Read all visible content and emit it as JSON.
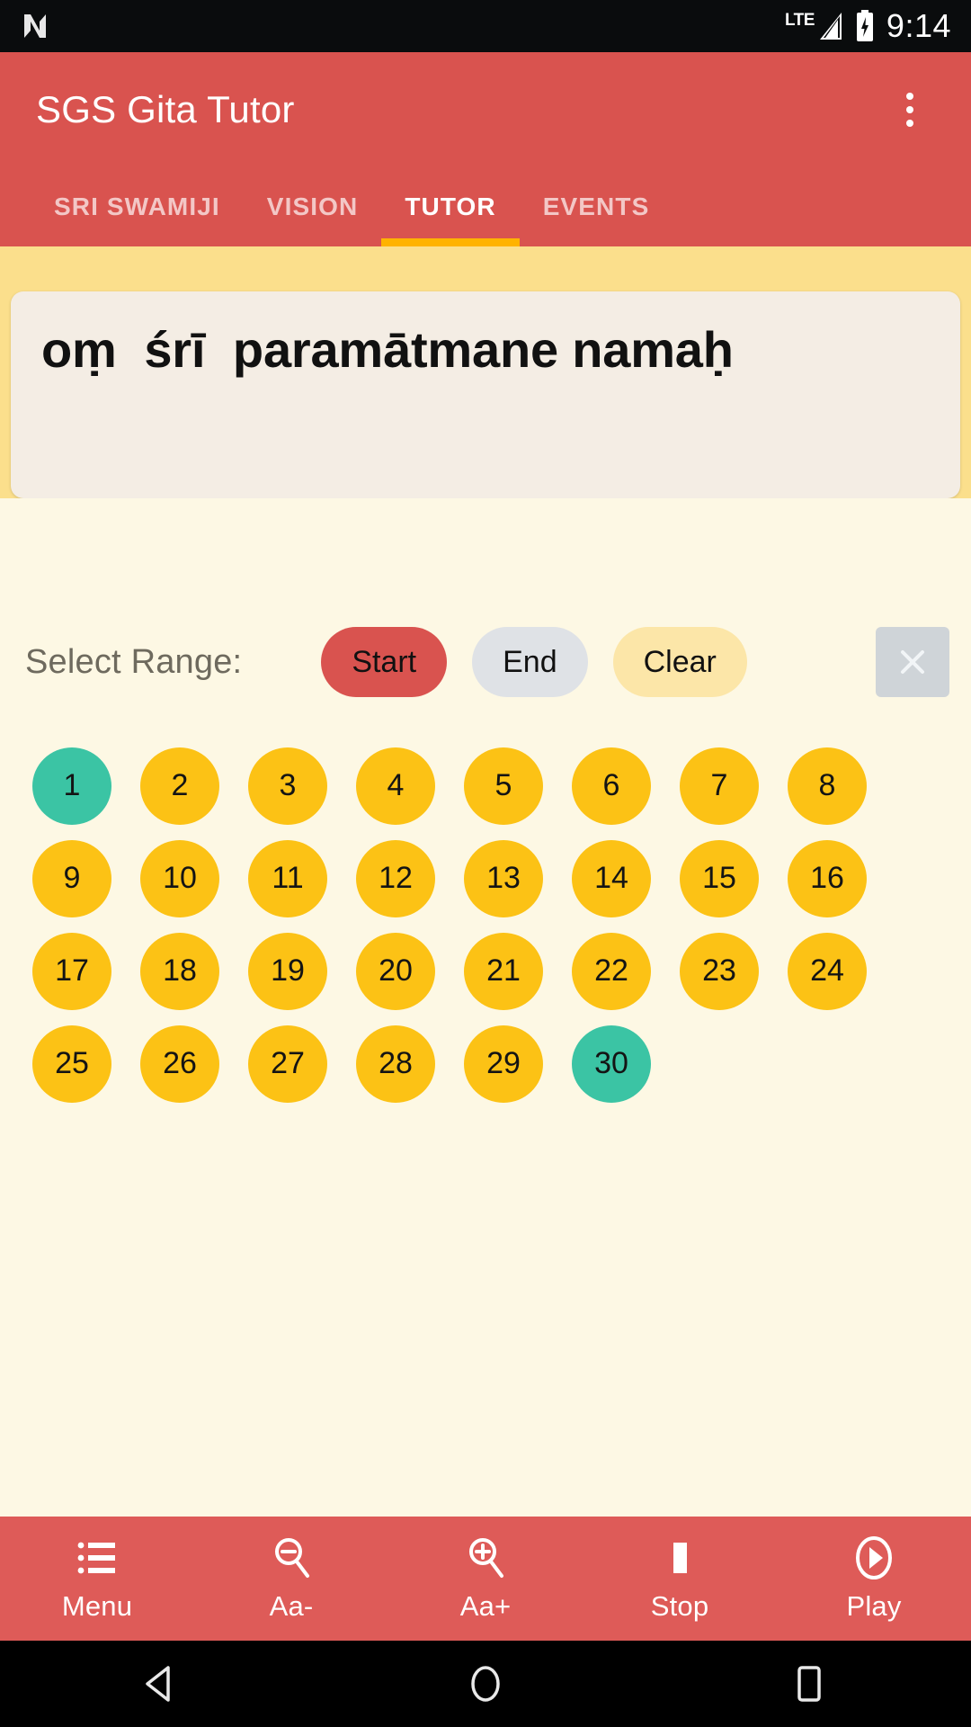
{
  "statusbar": {
    "logo_icon": "n-logo-icon",
    "network_label": "LTE",
    "signal_icon": "signal-bars-icon",
    "battery_icon": "battery-charging-icon",
    "clock": "9:14"
  },
  "appbar": {
    "title": "SGS Gita Tutor",
    "overflow_icon": "more-vertical-icon",
    "bar_color": "#D9534F",
    "indicator_color": "#FFB300",
    "tabs": [
      {
        "label": "SRI SWAMIJI",
        "active": false
      },
      {
        "label": "VISION",
        "active": false
      },
      {
        "label": "TUTOR",
        "active": true
      },
      {
        "label": "EVENTS",
        "active": false
      }
    ]
  },
  "verse": {
    "text": "oṃ  śrī  paramātmane namaḥ",
    "card_color": "#F4EDE4",
    "band_color": "#FBDF8C"
  },
  "range": {
    "label": "Select Range:",
    "buttons": [
      {
        "label": "Start",
        "style": "start",
        "color": "#D9534F"
      },
      {
        "label": "End",
        "style": "end",
        "color": "#DFE2E6"
      },
      {
        "label": "Clear",
        "style": "clear",
        "color": "#FCE6A8"
      }
    ],
    "close_icon": "close-icon"
  },
  "numbers": {
    "selected_color": "#3BC4A4",
    "default_color": "#FCC215",
    "items": [
      {
        "label": "1",
        "selected": true
      },
      {
        "label": "2",
        "selected": false
      },
      {
        "label": "3",
        "selected": false
      },
      {
        "label": "4",
        "selected": false
      },
      {
        "label": "5",
        "selected": false
      },
      {
        "label": "6",
        "selected": false
      },
      {
        "label": "7",
        "selected": false
      },
      {
        "label": "8",
        "selected": false
      },
      {
        "label": "9",
        "selected": false
      },
      {
        "label": "10",
        "selected": false
      },
      {
        "label": "11",
        "selected": false
      },
      {
        "label": "12",
        "selected": false
      },
      {
        "label": "13",
        "selected": false
      },
      {
        "label": "14",
        "selected": false
      },
      {
        "label": "15",
        "selected": false
      },
      {
        "label": "16",
        "selected": false
      },
      {
        "label": "17",
        "selected": false
      },
      {
        "label": "18",
        "selected": false
      },
      {
        "label": "19",
        "selected": false
      },
      {
        "label": "20",
        "selected": false
      },
      {
        "label": "21",
        "selected": false
      },
      {
        "label": "22",
        "selected": false
      },
      {
        "label": "23",
        "selected": false
      },
      {
        "label": "24",
        "selected": false
      },
      {
        "label": "25",
        "selected": false
      },
      {
        "label": "26",
        "selected": false
      },
      {
        "label": "27",
        "selected": false
      },
      {
        "label": "28",
        "selected": false
      },
      {
        "label": "29",
        "selected": false
      },
      {
        "label": "30",
        "selected": true
      }
    ]
  },
  "bottombar": {
    "bar_color": "#DE5B58",
    "items": [
      {
        "label": "Menu",
        "icon": "list-menu-icon"
      },
      {
        "label": "Aa-",
        "icon": "zoom-out-icon"
      },
      {
        "label": "Aa+",
        "icon": "zoom-in-icon"
      },
      {
        "label": "Stop",
        "icon": "stop-square-icon"
      },
      {
        "label": "Play",
        "icon": "play-circle-icon"
      }
    ]
  },
  "navbar": {
    "back_icon": "back-triangle-icon",
    "home_icon": "home-circle-icon",
    "recents_icon": "recents-square-icon"
  }
}
